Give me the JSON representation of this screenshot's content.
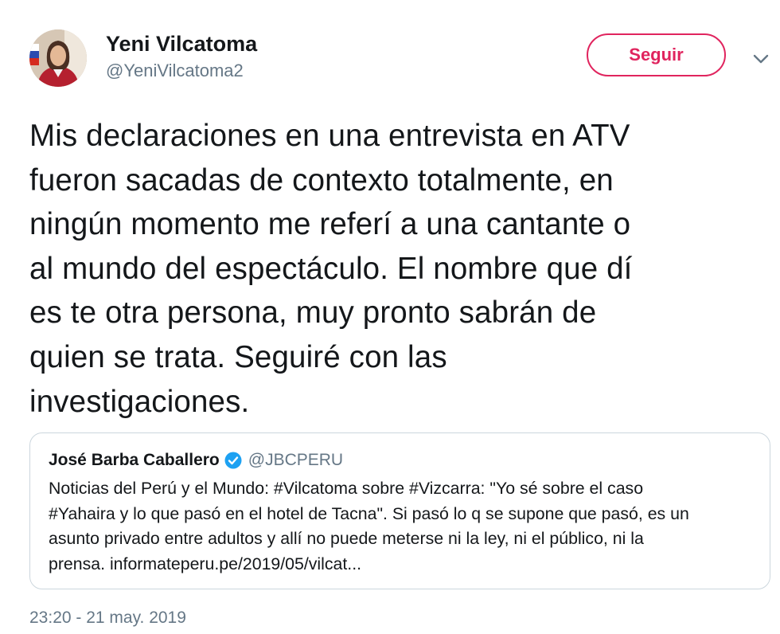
{
  "tweet": {
    "author": {
      "name": "Yeni Vilcatoma",
      "handle": "@YeniVilcatoma2"
    },
    "follow_label": "Seguir",
    "text_lines": [
      "Mis declaraciones en una entrevista en ATV",
      "fueron sacadas de contexto totalmente, en",
      "ningún momento me referí a una cantante o",
      "al mundo del espectáculo. El nombre que dí",
      "es te otra persona, muy pronto sabrán de",
      "quien se trata. Seguiré con las",
      "investigaciones."
    ],
    "timestamp": "23:20 - 21 may. 2019"
  },
  "quoted": {
    "name": "José Barba Caballero",
    "handle": "@JBCPERU",
    "text_lines": [
      "Noticias del Perú y el Mundo: #Vilcatoma sobre #Vizcarra: \"Yo sé sobre el caso",
      "#Yahaira y lo que pasó en el hotel de Tacna\". Si pasó lo q se supone que pasó, es un",
      "asunto privado entre adultos y allí no puede meterse ni la ley, ni el público, ni la",
      "prensa. informateperu.pe/2019/05/vilcat..."
    ]
  },
  "colors": {
    "follow_accent": "#e0245e",
    "verified_blue": "#1da1f2",
    "secondary_text": "#657786",
    "border": "#ccd6dd"
  },
  "icons": {
    "more": "chevron-down-icon",
    "verified": "verified-badge-icon"
  }
}
